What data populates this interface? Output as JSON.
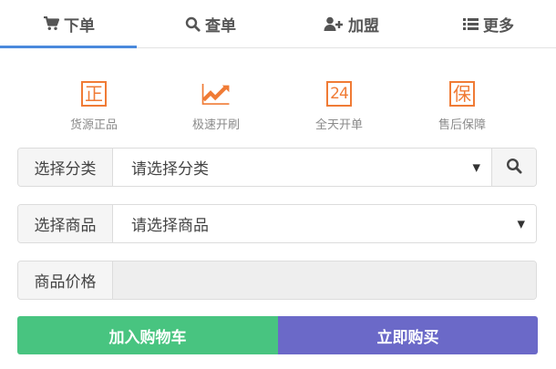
{
  "tabs": [
    {
      "label": "下单",
      "icon": "cart-icon",
      "active": true
    },
    {
      "label": "查单",
      "icon": "search-icon",
      "active": false
    },
    {
      "label": "加盟",
      "icon": "add-user-icon",
      "active": false
    },
    {
      "label": "更多",
      "icon": "list-icon",
      "active": false
    }
  ],
  "features": [
    {
      "label": "货源正品",
      "glyph": "正",
      "icon": "genuine-badge-icon"
    },
    {
      "label": "极速开刷",
      "glyph": "",
      "icon": "trend-up-icon"
    },
    {
      "label": "全天开单",
      "glyph": "24",
      "icon": "24-hour-icon"
    },
    {
      "label": "售后保障",
      "glyph": "保",
      "icon": "guarantee-badge-icon"
    }
  ],
  "form": {
    "category": {
      "label": "选择分类",
      "value": "请选择分类"
    },
    "product": {
      "label": "选择商品",
      "value": "请选择商品"
    },
    "price": {
      "label": "商品价格",
      "value": ""
    }
  },
  "actions": {
    "add_to_cart": "加入购物车",
    "buy_now": "立即购买"
  },
  "colors": {
    "accent_tab": "#4a89dc",
    "feature_orange": "#f07b35",
    "cart_green": "#48c480",
    "buy_purple": "#6b69c8"
  }
}
